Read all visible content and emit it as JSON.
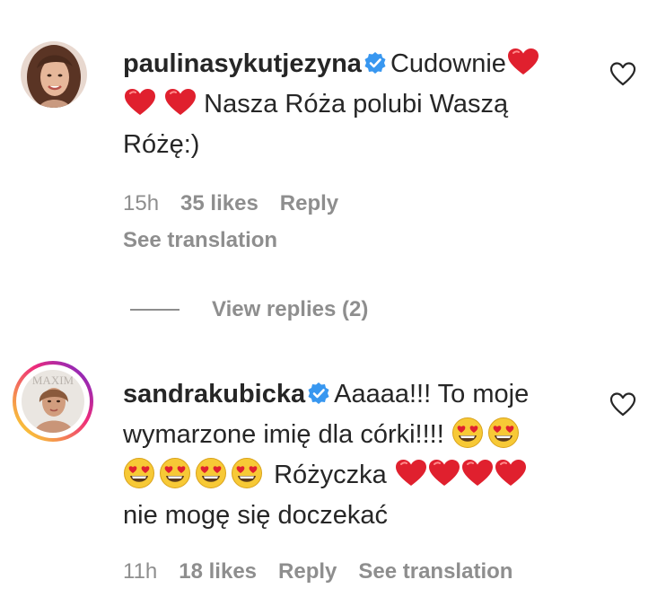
{
  "comments": [
    {
      "username": "paulinasykutjezyna",
      "text_a": "Cudownie",
      "text_b": "Nasza Róża polubi Waszą",
      "text_c": "Różę:)",
      "time": "15h",
      "likes": "35 likes",
      "reply": "Reply",
      "see_translation": "See translation",
      "view_replies": "View replies (2)"
    },
    {
      "username": "sandrakubicka",
      "text_a": "Aaaaa!!! To moje",
      "text_b": "wymarzone imię dla córki!!!!",
      "text_c": "Różyczka",
      "text_d": "nie mogę się doczekać",
      "time": "11h",
      "likes": "18 likes",
      "reply": "Reply",
      "see_translation": "See translation"
    }
  ],
  "colors": {
    "text": "#262626",
    "muted": "#8e8e8e",
    "verified": "#3897f0",
    "heart": "#e0202e",
    "story_ring_start": "#f9ce34",
    "story_ring_end": "#ee2a7b"
  },
  "icons": {
    "verified": "verified-badge-icon",
    "like": "heart-outline-icon",
    "red_heart": "red-heart-emoji",
    "heart_eyes": "heart-eyes-emoji"
  }
}
